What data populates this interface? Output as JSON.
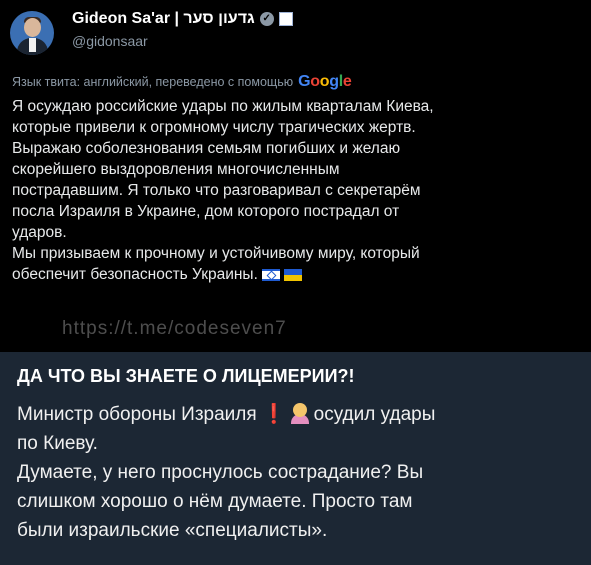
{
  "tweet": {
    "author_name": "Gideon Sa'ar | גדעון סער",
    "handle": "@gidonsaar",
    "translation_label": "Язык твита: английский, переведено с помощью",
    "google": "Google",
    "lines": [
      "Я осуждаю российские удары по жилым кварталам Киева,",
      "которые привели к огромному числу трагических жертв.",
      "Выражаю соболезнования семьям погибших и желаю",
      "скорейшего выздоровления многочисленным",
      "пострадавшим. Я только что разговаривал с секретарём",
      "посла Израиля в Украине, дом которого пострадал от",
      "ударов.",
      "Мы призываем к прочному и устойчивому миру, который",
      "обеспечит безопасность Украины."
    ],
    "watermark": "https://t.me/codeseven7"
  },
  "message": {
    "title": "ДА ЧТО ВЫ ЗНАЕТЕ О ЛИЦЕМЕРИИ?!",
    "line1_a": "Министр обороны Израиля",
    "line1_b": "осудил удары",
    "line2": "по Киеву.",
    "line3": "Думаете, у него проснулось сострадание? Вы",
    "line4": "слишком хорошо о нём думаете. Просто там",
    "line5": "были израильские «специалисты»."
  },
  "colors": {
    "tweet_bg": "#000000",
    "message_bg": "#1c2734",
    "exclamation": "#e0262b"
  }
}
